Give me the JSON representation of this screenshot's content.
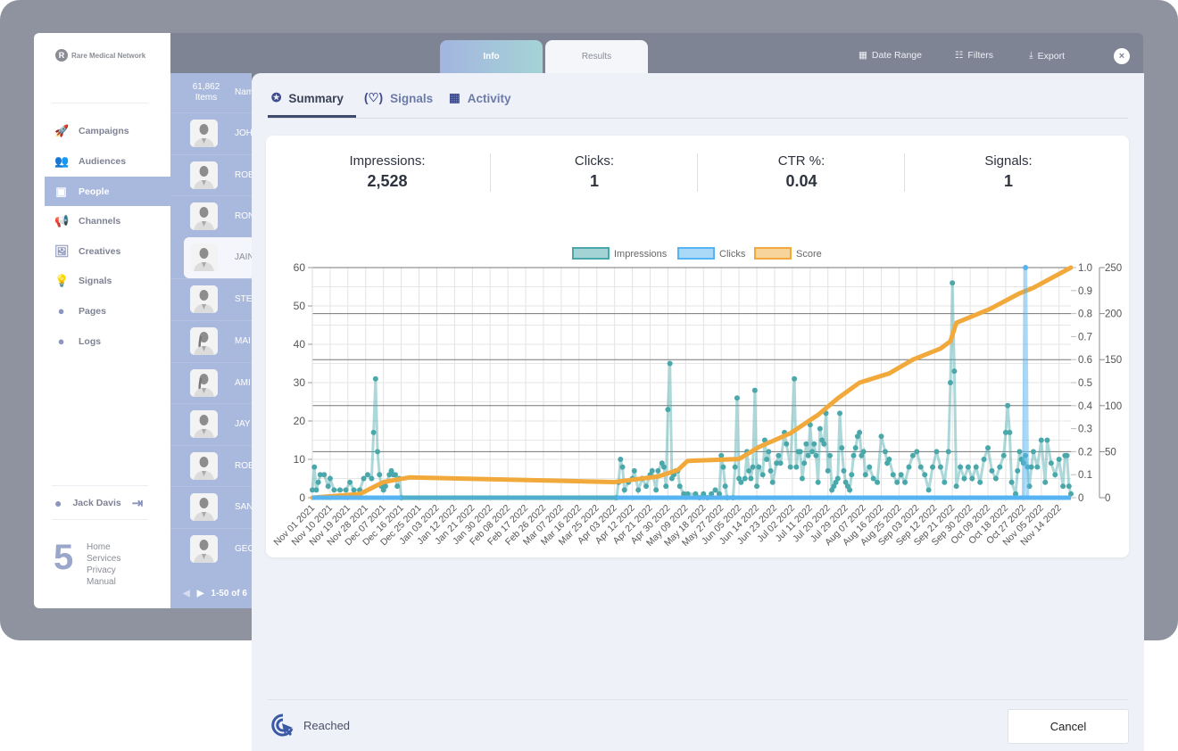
{
  "brand": {
    "name": "Rare Medical Network",
    "logo_letter": "R"
  },
  "sidebar": {
    "items": [
      {
        "label": "Campaigns",
        "icon": "rocket-icon",
        "glyph": "🚀"
      },
      {
        "label": "Audiences",
        "icon": "users-icon",
        "glyph": "👥"
      },
      {
        "label": "People",
        "icon": "contact-card-icon",
        "glyph": "▣",
        "active": true
      },
      {
        "label": "Channels",
        "icon": "megaphone-icon",
        "glyph": "📢"
      },
      {
        "label": "Creatives",
        "icon": "image-icon",
        "glyph": "🖼"
      },
      {
        "label": "Signals",
        "icon": "lightbulb-icon",
        "glyph": "💡"
      },
      {
        "label": "Pages",
        "icon": "globe-icon",
        "glyph": "●"
      },
      {
        "label": "Logs",
        "icon": "user-circle-icon",
        "glyph": "●"
      }
    ],
    "user": "Jack Davis",
    "footer_logo": "5",
    "footer_links": [
      "Home",
      "Services",
      "Privacy",
      "Manual"
    ]
  },
  "people": {
    "count": "61,862",
    "count_label": "Items",
    "column": "Nam",
    "rows": [
      "JOH",
      "ROB",
      "RON",
      "JAIN",
      "STE",
      "MAI",
      "AMI",
      "JAY",
      "ROB",
      "SAN",
      "GEO"
    ],
    "selected_index": 3,
    "female_rows": [
      5,
      6
    ],
    "pagination": "1-50 of 6"
  },
  "header": {
    "tabs": [
      "Info",
      "Results"
    ],
    "actions": {
      "date_range": "Date Range",
      "filters": "Filters",
      "export": "Export"
    },
    "close": "×"
  },
  "modal": {
    "tabs": [
      {
        "label": "Summary",
        "icon": "star-badge-icon"
      },
      {
        "label": "Signals",
        "icon": "lightbulb-icon"
      },
      {
        "label": "Activity",
        "icon": "calendar-icon"
      }
    ],
    "stats": [
      {
        "label": "Impressions:",
        "value": "2,528"
      },
      {
        "label": "Clicks:",
        "value": "1"
      },
      {
        "label": "CTR %:",
        "value": "0.04"
      },
      {
        "label": "Signals:",
        "value": "1"
      }
    ],
    "footer": {
      "status": "Reached",
      "cancel": "Cancel"
    }
  },
  "chart_data": {
    "type": "line",
    "legend": [
      "Impressions",
      "Clicks",
      "Score"
    ],
    "legend_position": "top",
    "colors": {
      "Impressions": "#4aa8ab",
      "Clicks": "#56b4f2",
      "Score": "#f2a93b"
    },
    "x_range": [
      "2021-11-01",
      "2022-11-20"
    ],
    "x_tick_labels": [
      "Nov 01 2021",
      "Nov 10 2021",
      "Nov 19 2021",
      "Nov 28 2021",
      "Dec 07 2021",
      "Dec 16 2021",
      "Dec 25 2021",
      "Jan 03 2022",
      "Jan 12 2022",
      "Jan 21 2022",
      "Jan 30 2022",
      "Feb 08 2022",
      "Feb 17 2022",
      "Feb 26 2022",
      "Mar 07 2022",
      "Mar 16 2022",
      "Mar 25 2022",
      "Apr 03 2022",
      "Apr 12 2022",
      "Apr 21 2022",
      "Apr 30 2022",
      "May 09 2022",
      "May 18 2022",
      "May 27 2022",
      "Jun 05 2022",
      "Jun 14 2022",
      "Jun 23 2022",
      "Jul 02 2022",
      "Jul 11 2022",
      "Jul 20 2022",
      "Jul 29 2022",
      "Aug 07 2022",
      "Aug 16 2022",
      "Aug 25 2022",
      "Sep 03 2022",
      "Sep 12 2022",
      "Sep 21 2022",
      "Sep 30 2022",
      "Oct 09 2022",
      "Oct 18 2022",
      "Oct 27 2022",
      "Nov 05 2022",
      "Nov 14 2022"
    ],
    "axes": {
      "impressions": {
        "range": [
          0,
          60
        ],
        "ticks": [
          "0",
          "10",
          "20",
          "30",
          "40",
          "50",
          "60"
        ]
      },
      "clicks": {
        "range": [
          0,
          1
        ],
        "ticks": [
          "0",
          "0.1",
          "0.2",
          "0.3",
          "0.4",
          "0.5",
          "0.6",
          "0.7",
          "0.8",
          "0.9",
          "1.0"
        ]
      },
      "score": {
        "range": [
          0,
          250
        ],
        "ticks": [
          "0",
          "50",
          "100",
          "150",
          "200",
          "250"
        ]
      }
    },
    "grid": true,
    "series": [
      {
        "name": "Impressions",
        "axis": "impressions",
        "points": [
          [
            "2021-11-01",
            2
          ],
          [
            "2021-11-02",
            8
          ],
          [
            "2021-11-03",
            2
          ],
          [
            "2021-11-04",
            4
          ],
          [
            "2021-11-05",
            6
          ],
          [
            "2021-11-07",
            6
          ],
          [
            "2021-11-09",
            3
          ],
          [
            "2021-11-10",
            5
          ],
          [
            "2021-11-12",
            2
          ],
          [
            "2021-11-15",
            2
          ],
          [
            "2021-11-18",
            2
          ],
          [
            "2021-11-20",
            4
          ],
          [
            "2021-11-22",
            2
          ],
          [
            "2021-11-25",
            2
          ],
          [
            "2021-11-27",
            5
          ],
          [
            "2021-11-29",
            6
          ],
          [
            "2021-12-01",
            5
          ],
          [
            "2021-12-02",
            17
          ],
          [
            "2021-12-03",
            31
          ],
          [
            "2021-12-04",
            12
          ],
          [
            "2021-12-05",
            6
          ],
          [
            "2021-12-06",
            3
          ],
          [
            "2021-12-07",
            2
          ],
          [
            "2021-12-08",
            3
          ],
          [
            "2021-12-10",
            6
          ],
          [
            "2021-12-11",
            7
          ],
          [
            "2021-12-12",
            6
          ],
          [
            "2021-12-13",
            6
          ],
          [
            "2021-12-14",
            3
          ],
          [
            "2021-12-15",
            5
          ],
          [
            "2021-12-16",
            0
          ],
          [
            "2022-04-04",
            0
          ],
          [
            "2022-04-05",
            4
          ],
          [
            "2022-04-06",
            10
          ],
          [
            "2022-04-07",
            8
          ],
          [
            "2022-04-08",
            2
          ],
          [
            "2022-04-10",
            4
          ],
          [
            "2022-04-12",
            5
          ],
          [
            "2022-04-13",
            7
          ],
          [
            "2022-04-15",
            2
          ],
          [
            "2022-04-17",
            5
          ],
          [
            "2022-04-19",
            3
          ],
          [
            "2022-04-21",
            6
          ],
          [
            "2022-04-22",
            7
          ],
          [
            "2022-04-24",
            2
          ],
          [
            "2022-04-25",
            7
          ],
          [
            "2022-04-27",
            9
          ],
          [
            "2022-04-28",
            8
          ],
          [
            "2022-04-29",
            3
          ],
          [
            "2022-04-30",
            23
          ],
          [
            "2022-05-01",
            35
          ],
          [
            "2022-05-02",
            5
          ],
          [
            "2022-05-03",
            6
          ],
          [
            "2022-05-04",
            7
          ],
          [
            "2022-05-05",
            7
          ],
          [
            "2022-05-06",
            3
          ],
          [
            "2022-05-08",
            1
          ],
          [
            "2022-05-10",
            1
          ],
          [
            "2022-05-14",
            1
          ],
          [
            "2022-05-16",
            0
          ],
          [
            "2022-05-18",
            1
          ],
          [
            "2022-05-20",
            0
          ],
          [
            "2022-05-22",
            1
          ],
          [
            "2022-05-24",
            2
          ],
          [
            "2022-05-26",
            1
          ],
          [
            "2022-05-27",
            11
          ],
          [
            "2022-05-28",
            8
          ],
          [
            "2022-05-29",
            3
          ],
          [
            "2022-05-30",
            0
          ],
          [
            "2022-06-02",
            0
          ],
          [
            "2022-06-03",
            8
          ],
          [
            "2022-06-04",
            26
          ],
          [
            "2022-06-05",
            5
          ],
          [
            "2022-06-06",
            4
          ],
          [
            "2022-06-08",
            5
          ],
          [
            "2022-06-09",
            12
          ],
          [
            "2022-06-10",
            7
          ],
          [
            "2022-06-11",
            5
          ],
          [
            "2022-06-12",
            8
          ],
          [
            "2022-06-13",
            28
          ],
          [
            "2022-06-14",
            3
          ],
          [
            "2022-06-15",
            8
          ],
          [
            "2022-06-17",
            6
          ],
          [
            "2022-06-18",
            15
          ],
          [
            "2022-06-19",
            10
          ],
          [
            "2022-06-20",
            12
          ],
          [
            "2022-06-21",
            7
          ],
          [
            "2022-06-22",
            4
          ],
          [
            "2022-06-24",
            9
          ],
          [
            "2022-06-25",
            11
          ],
          [
            "2022-06-26",
            9
          ],
          [
            "2022-06-28",
            17
          ],
          [
            "2022-06-29",
            14
          ],
          [
            "2022-07-01",
            8
          ],
          [
            "2022-07-03",
            31
          ],
          [
            "2022-07-04",
            8
          ],
          [
            "2022-07-05",
            12
          ],
          [
            "2022-07-06",
            12
          ],
          [
            "2022-07-07",
            5
          ],
          [
            "2022-07-08",
            9
          ],
          [
            "2022-07-09",
            14
          ],
          [
            "2022-07-10",
            11
          ],
          [
            "2022-07-11",
            19
          ],
          [
            "2022-07-12",
            12
          ],
          [
            "2022-07-13",
            14
          ],
          [
            "2022-07-14",
            11
          ],
          [
            "2022-07-15",
            4
          ],
          [
            "2022-07-16",
            18
          ],
          [
            "2022-07-17",
            15
          ],
          [
            "2022-07-18",
            14
          ],
          [
            "2022-07-19",
            22
          ],
          [
            "2022-07-20",
            7
          ],
          [
            "2022-07-21",
            11
          ],
          [
            "2022-07-22",
            2
          ],
          [
            "2022-07-23",
            3
          ],
          [
            "2022-07-24",
            4
          ],
          [
            "2022-07-25",
            5
          ],
          [
            "2022-07-26",
            22
          ],
          [
            "2022-07-27",
            13
          ],
          [
            "2022-07-28",
            7
          ],
          [
            "2022-07-29",
            4
          ],
          [
            "2022-07-30",
            3
          ],
          [
            "2022-07-31",
            2
          ],
          [
            "2022-08-01",
            6
          ],
          [
            "2022-08-02",
            11
          ],
          [
            "2022-08-03",
            13
          ],
          [
            "2022-08-04",
            16
          ],
          [
            "2022-08-05",
            17
          ],
          [
            "2022-08-06",
            11
          ],
          [
            "2022-08-07",
            12
          ],
          [
            "2022-08-08",
            6
          ],
          [
            "2022-08-10",
            8
          ],
          [
            "2022-08-12",
            5
          ],
          [
            "2022-08-14",
            4
          ],
          [
            "2022-08-16",
            16
          ],
          [
            "2022-08-18",
            12
          ],
          [
            "2022-08-19",
            9
          ],
          [
            "2022-08-20",
            10
          ],
          [
            "2022-08-22",
            6
          ],
          [
            "2022-08-24",
            4
          ],
          [
            "2022-08-26",
            6
          ],
          [
            "2022-08-28",
            4
          ],
          [
            "2022-08-30",
            8
          ],
          [
            "2022-09-01",
            11
          ],
          [
            "2022-09-03",
            12
          ],
          [
            "2022-09-05",
            8
          ],
          [
            "2022-09-07",
            6
          ],
          [
            "2022-09-09",
            2
          ],
          [
            "2022-09-11",
            8
          ],
          [
            "2022-09-13",
            12
          ],
          [
            "2022-09-15",
            8
          ],
          [
            "2022-09-17",
            4
          ],
          [
            "2022-09-19",
            12
          ],
          [
            "2022-09-20",
            30
          ],
          [
            "2022-09-21",
            56
          ],
          [
            "2022-09-22",
            33
          ],
          [
            "2022-09-23",
            3
          ],
          [
            "2022-09-25",
            8
          ],
          [
            "2022-09-27",
            5
          ],
          [
            "2022-09-29",
            8
          ],
          [
            "2022-10-01",
            5
          ],
          [
            "2022-10-03",
            8
          ],
          [
            "2022-10-05",
            4
          ],
          [
            "2022-10-07",
            10
          ],
          [
            "2022-10-09",
            13
          ],
          [
            "2022-10-11",
            7
          ],
          [
            "2022-10-13",
            5
          ],
          [
            "2022-10-15",
            8
          ],
          [
            "2022-10-17",
            11
          ],
          [
            "2022-10-18",
            17
          ],
          [
            "2022-10-19",
            24
          ],
          [
            "2022-10-20",
            17
          ],
          [
            "2022-10-21",
            4
          ],
          [
            "2022-10-23",
            1
          ],
          [
            "2022-10-24",
            7
          ],
          [
            "2022-10-25",
            12
          ],
          [
            "2022-10-26",
            10
          ],
          [
            "2022-10-27",
            9
          ],
          [
            "2022-10-28",
            11
          ],
          [
            "2022-10-29",
            8
          ],
          [
            "2022-10-30",
            3
          ],
          [
            "2022-10-31",
            8
          ],
          [
            "2022-11-01",
            12
          ],
          [
            "2022-11-03",
            8
          ],
          [
            "2022-11-05",
            15
          ],
          [
            "2022-11-07",
            4
          ],
          [
            "2022-11-08",
            15
          ],
          [
            "2022-11-10",
            9
          ],
          [
            "2022-11-12",
            6
          ],
          [
            "2022-11-14",
            10
          ],
          [
            "2022-11-16",
            3
          ],
          [
            "2022-11-17",
            11
          ],
          [
            "2022-11-18",
            11
          ],
          [
            "2022-11-19",
            3
          ],
          [
            "2022-11-20",
            1
          ]
        ]
      },
      {
        "name": "Clicks",
        "axis": "clicks",
        "points": [
          [
            "2021-11-01",
            0
          ],
          [
            "2022-10-27",
            0
          ],
          [
            "2022-10-28",
            1
          ],
          [
            "2022-10-29",
            0
          ],
          [
            "2022-11-20",
            0
          ]
        ]
      },
      {
        "name": "Score",
        "axis": "score",
        "points": [
          [
            "2021-11-01",
            0
          ],
          [
            "2021-11-25",
            4
          ],
          [
            "2021-12-07",
            17
          ],
          [
            "2021-12-20",
            22
          ],
          [
            "2022-04-03",
            17
          ],
          [
            "2022-04-25",
            23
          ],
          [
            "2022-05-05",
            30
          ],
          [
            "2022-05-10",
            40
          ],
          [
            "2022-06-05",
            42
          ],
          [
            "2022-06-15",
            55
          ],
          [
            "2022-07-01",
            70
          ],
          [
            "2022-07-15",
            90
          ],
          [
            "2022-07-25",
            108
          ],
          [
            "2022-08-05",
            125
          ],
          [
            "2022-08-20",
            135
          ],
          [
            "2022-09-01",
            150
          ],
          [
            "2022-09-15",
            162
          ],
          [
            "2022-09-20",
            170
          ],
          [
            "2022-09-23",
            190
          ],
          [
            "2022-10-10",
            205
          ],
          [
            "2022-10-25",
            222
          ],
          [
            "2022-11-01",
            228
          ],
          [
            "2022-11-20",
            250
          ]
        ]
      }
    ]
  }
}
